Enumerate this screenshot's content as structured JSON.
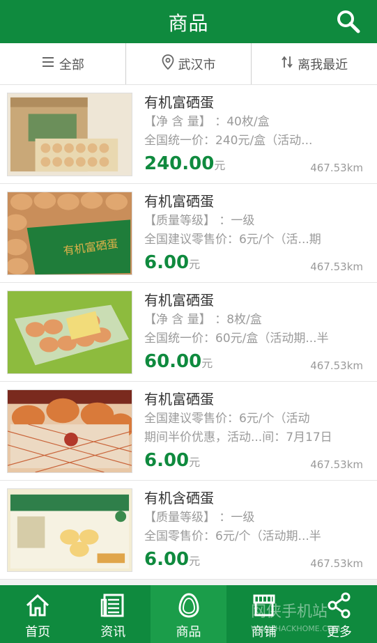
{
  "header": {
    "title": "商品"
  },
  "filters": [
    {
      "label": "全部",
      "icon": "menu-icon"
    },
    {
      "label": "武汉市",
      "icon": "location-pin-icon"
    },
    {
      "label": "离我最近",
      "icon": "sort-arrows-icon"
    }
  ],
  "products": [
    {
      "name": "有机富硒蛋",
      "lines": [
        "【净 含 量】 ：40枚/盒",
        "全国统一价：240元/盒（活动..."
      ],
      "price": "240.00",
      "unit": "元",
      "distance": "467.53km"
    },
    {
      "name": "有机富硒蛋",
      "lines": [
        "【质量等级】 ：一级",
        "全国建议零售价：6元/个（活...期"
      ],
      "price": "6.00",
      "unit": "元",
      "distance": "467.53km"
    },
    {
      "name": "有机富硒蛋",
      "lines": [
        "【净 含 量】 ：8枚/盒",
        "全国统一价：60元/盒（活动期...半"
      ],
      "price": "60.00",
      "unit": "元",
      "distance": "467.53km"
    },
    {
      "name": "有机富硒蛋",
      "lines": [
        "全国建议零售价：6元/个（活动",
        "期间半价优惠，活动...间：7月17日"
      ],
      "price": "6.00",
      "unit": "元",
      "distance": "467.53km"
    },
    {
      "name": "有机含硒蛋",
      "lines": [
        "【质量等级】 ：一级",
        "全国零售价：6元/个（活动期...半"
      ],
      "price": "6.00",
      "unit": "元",
      "distance": "467.53km"
    }
  ],
  "tabs": [
    {
      "label": "首页",
      "icon": "home-icon"
    },
    {
      "label": "资讯",
      "icon": "news-icon"
    },
    {
      "label": "商品",
      "icon": "egg-icon",
      "active": true
    },
    {
      "label": "商铺",
      "icon": "shop-icon"
    },
    {
      "label": "更多",
      "icon": "share-icon"
    }
  ],
  "watermark": {
    "text": "网侠手机站",
    "url": "WWW.HACKHOME.COM"
  },
  "colors": {
    "primary": "#0f8a3e",
    "price": "#0f8a3e"
  }
}
